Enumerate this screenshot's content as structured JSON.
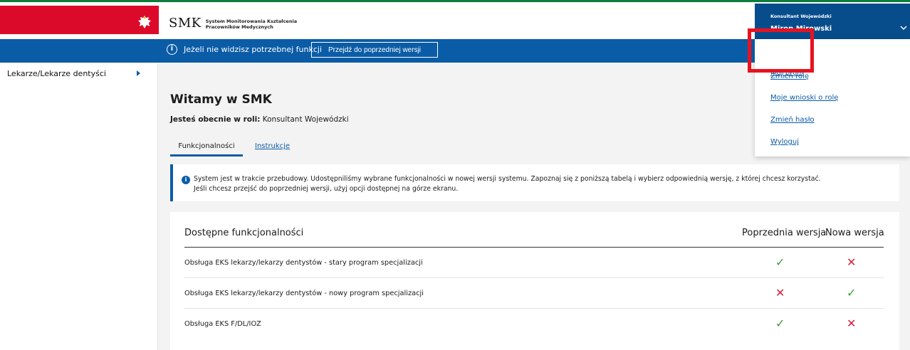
{
  "header": {
    "logo_text": "SMK",
    "logo_subtitle_line1": "System Monitorowania Kształcenia",
    "logo_subtitle_line2": "Pracowników Medycznych",
    "user_role": "Konsultant Wojewódzki",
    "user_name": "Miron Mirowski",
    "colors": {
      "flag_red": "#dc0a2a",
      "brand_blue": "#0b5ca6",
      "user_box_blue": "#074d8c",
      "top_border_green": "#0e7c3a"
    }
  },
  "notice_bar": {
    "text": "Jeżeli nie widzisz potrzebnej funkcji",
    "button_label": "Przejdź do poprzedniej wersji"
  },
  "sidebar": {
    "items": [
      {
        "label": "Lekarze/Lekarze dentyści"
      }
    ]
  },
  "main": {
    "title": "Witamy w SMK",
    "role_prefix": "Jesteś obecnie w roli:",
    "role_value": "Konsultant Wojewódzki",
    "tabs": [
      {
        "label": "Funkcjonalności",
        "active": true
      },
      {
        "label": "Instrukcje",
        "active": false
      }
    ],
    "alert": {
      "line1": "System jest w trakcie przebudowy. Udostępniliśmy wybrane funkcjonalności w nowej wersji systemu. Zapoznaj się z poniższą tabelą i wybierz odpowiednią wersję, z której chcesz korzystać.",
      "line2": "Jeśli chcesz przejść do poprzedniej wersji, użyj opcji dostępnej na górze ekranu."
    },
    "table": {
      "headers": [
        "Dostępne funkcjonalności",
        "Poprzednia wersja",
        "Nowa wersja"
      ],
      "rows": [
        {
          "label": "Obsługa EKS lekarzy/lekarzy dentystów - stary program specjalizacji",
          "prev": "✓",
          "new": "✕"
        },
        {
          "label": "Obsługa EKS lekarzy/lekarzy dentystów - nowy program specjalizacji",
          "prev": "✕",
          "new": "✓"
        },
        {
          "label": "Obsługa EKS F/DL/IOZ",
          "prev": "✓",
          "new": "✕"
        }
      ]
    }
  },
  "user_menu": {
    "items": [
      {
        "label": "Mój profil"
      },
      {
        "label": "Zmień rolę"
      },
      {
        "label": "Moje wnioski o rolę"
      },
      {
        "label": "Zmień hasło"
      },
      {
        "label": "Wyloguj"
      }
    ],
    "highlight_color": "#e8121f"
  }
}
